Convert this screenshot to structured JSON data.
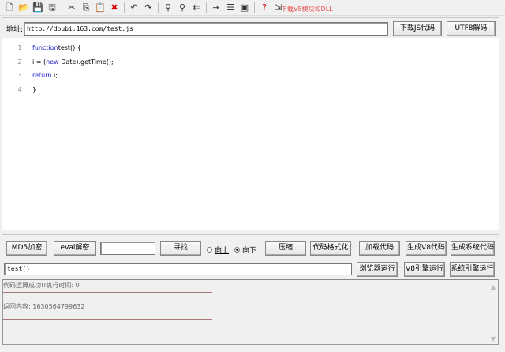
{
  "toolbar": {
    "icons": [
      "new-file-icon",
      "open-folder-icon",
      "save-icon",
      "save-all-icon",
      "cut-icon",
      "copy-icon",
      "paste-icon",
      "delete-icon",
      "undo-icon",
      "redo-icon",
      "find-icon",
      "find-next-icon",
      "replace-icon",
      "indent-icon",
      "list-icon",
      "window-icon",
      "help-cursor-icon",
      "exit-icon"
    ],
    "download_link": "下载V8模块和DLL"
  },
  "address": {
    "label": "地址:",
    "value": "http://doubi.163.com/test.js",
    "download_btn": "下载JS代码",
    "utf8_btn": "UTF8解码"
  },
  "editor": {
    "lines": [
      {
        "n": "1",
        "parts": [
          [
            "kw",
            "function"
          ],
          [
            "",
            "test() {"
          ]
        ]
      },
      {
        "n": "2",
        "parts": [
          [
            "",
            "i = ("
          ],
          [
            "kw",
            "new"
          ],
          [
            "",
            " Date).getTime();"
          ]
        ]
      },
      {
        "n": "3",
        "parts": [
          [
            "kw",
            "return"
          ],
          [
            "",
            " i;"
          ]
        ]
      },
      {
        "n": "4",
        "parts": [
          [
            "",
            "}"
          ]
        ]
      }
    ]
  },
  "controls": {
    "md5": "MD5加密",
    "eval": "eval解密",
    "search_value": "",
    "find": "寻找",
    "up": "向上",
    "down": "向下",
    "direction": "down",
    "compress": "压缩",
    "format": "代码格式化",
    "load": "加载代码",
    "gen_v8": "生成V8代码",
    "gen_sys": "生成系统代码",
    "run_input": "test()",
    "browser_run": "浏览器运行",
    "v8_run": "V8引擎运行",
    "sys_run": "系统引擎运行"
  },
  "output": {
    "line1": "代码运算成功!!执行时间: 0",
    "line2": "返回内容: 1630564799632"
  }
}
